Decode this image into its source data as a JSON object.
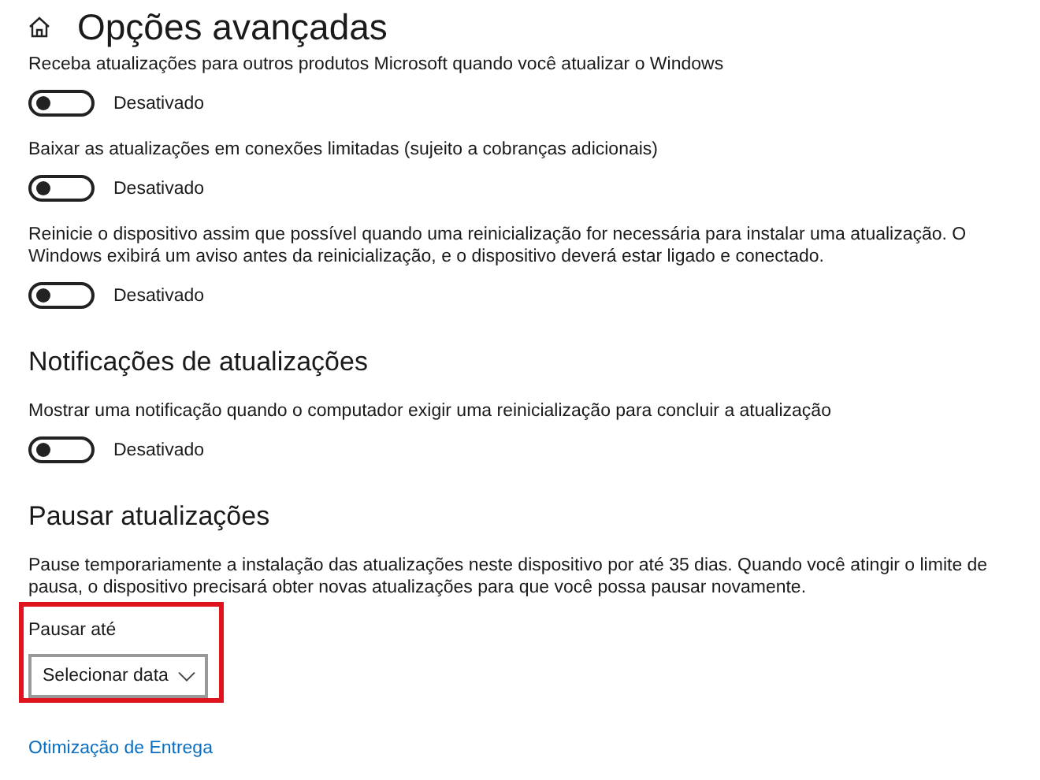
{
  "page": {
    "title": "Opções avançadas"
  },
  "sections": [
    {
      "items": [
        {
          "kind": "toggle",
          "description": "Receba atualizações para outros produtos Microsoft quando você atualizar o Windows",
          "on": false,
          "state_label": "Desativado"
        },
        {
          "kind": "toggle",
          "description": "Baixar as atualizações em conexões limitadas (sujeito a cobranças adicionais)",
          "on": false,
          "state_label": "Desativado"
        },
        {
          "kind": "toggle",
          "description": "Reinicie o dispositivo assim que possível quando uma reinicialização for necessária para instalar uma atualização. O Windows exibirá um aviso antes da reinicialização, e o dispositivo deverá estar ligado e conectado.",
          "on": false,
          "state_label": "Desativado"
        }
      ]
    },
    {
      "heading": "Notificações de atualizações",
      "items": [
        {
          "kind": "toggle",
          "description": "Mostrar uma notificação quando o computador exigir uma reinicialização para concluir a atualização",
          "on": false,
          "state_label": "Desativado"
        }
      ]
    },
    {
      "heading": "Pausar atualizações",
      "items": [
        {
          "kind": "text",
          "description": "Pause temporariamente a instalação das atualizações neste dispositivo por até 35 dias. Quando você atingir o limite de pausa, o dispositivo precisará obter novas atualizações para que você possa pausar novamente."
        },
        {
          "kind": "dropdown",
          "label": "Pausar até",
          "value": "Selecionar data",
          "highlighted": true
        }
      ]
    }
  ],
  "link": "Otimização de Entrega"
}
